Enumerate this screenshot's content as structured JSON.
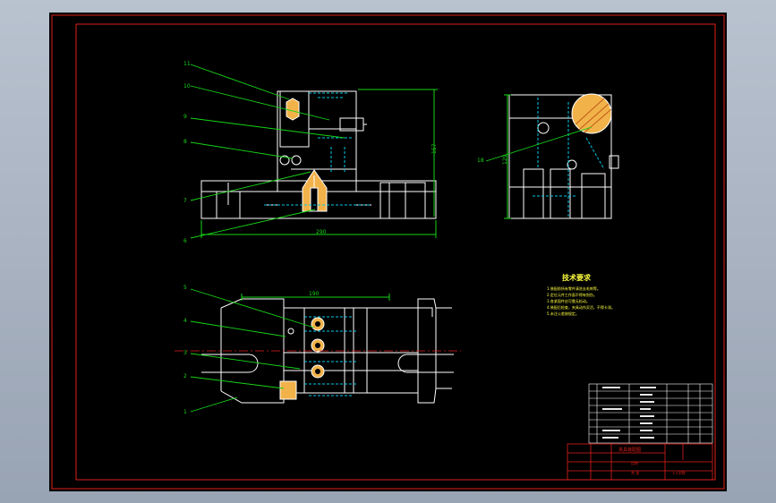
{
  "viewport": {
    "background": "#000000",
    "frame_color": "#e0201c",
    "geometry_color": "#ffffff",
    "leader_color": "#16d516",
    "hidden_color": "#00c8e6",
    "text_color": "#ffff40"
  },
  "callouts": {
    "c1": "1",
    "c2": "2",
    "c3": "3",
    "c4": "4",
    "c5": "5",
    "c6": "6",
    "c7": "7",
    "c8": "8",
    "c9": "9",
    "c10": "10",
    "c11": "11",
    "c18": "18"
  },
  "dimensions": {
    "front_width": "290",
    "front_height": "157",
    "side_height": "129",
    "top_width": "190"
  },
  "notes": {
    "title": "技术要求",
    "lines": [
      "1.装配前所有零件清洗去毛刺等。",
      "2.定位元件工作面不得有划伤。",
      "3.各紧固件应可靠无松动。",
      "4.装配后检查，夹具动作灵活，不得卡滞。",
      "5.未注公差按规定。"
    ]
  },
  "title_block": {
    "drawing_name": "夹具装配图",
    "scale_label": "比例",
    "sheet_label": "共 张",
    "company": "××学院"
  }
}
